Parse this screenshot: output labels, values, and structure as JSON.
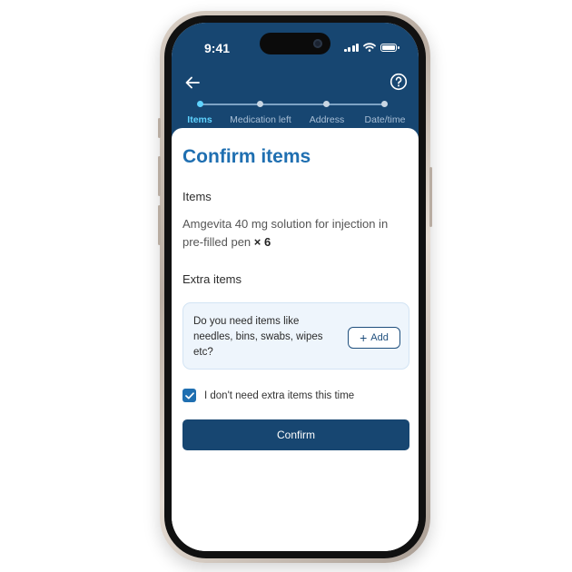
{
  "status_bar": {
    "time": "9:41"
  },
  "stepper": {
    "steps": [
      {
        "label": "Items",
        "active": true
      },
      {
        "label": "Medication left",
        "active": false
      },
      {
        "label": "Address",
        "active": false
      },
      {
        "label": "Date/time",
        "active": false
      }
    ]
  },
  "page": {
    "title": "Confirm items",
    "items_heading": "Items",
    "item_name": "Amgevita 40 mg solution for injection in pre-filled pen",
    "item_qty": "× 6",
    "extra_heading": "Extra items",
    "extra_prompt": "Do you need items like needles, bins, swabs, wipes etc?",
    "add_label": "Add",
    "checkbox_label": "I don't need extra items this time",
    "checkbox_checked": true,
    "confirm_label": "Confirm"
  },
  "colors": {
    "header_bg": "#174671",
    "accent": "#1f6fb1",
    "active_step": "#5fd3ff"
  }
}
